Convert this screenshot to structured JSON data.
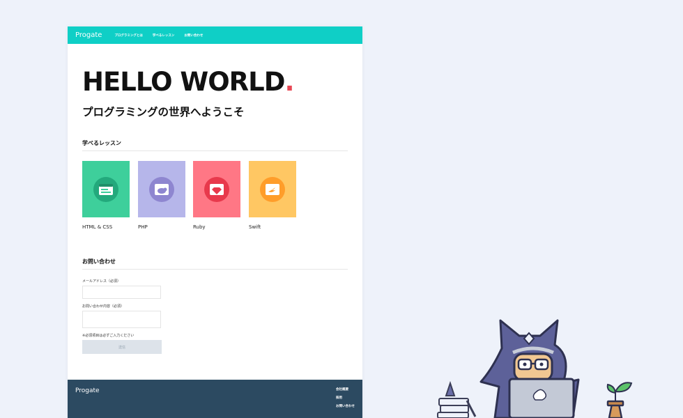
{
  "header": {
    "logo": "Progate",
    "nav": [
      "プログラミングとは",
      "学べるレッスン",
      "お問い合わせ"
    ]
  },
  "hero": {
    "title": "HELLO WORLD",
    "dot": ".",
    "subtitle": "プログラミングの世界へようこそ"
  },
  "lessons": {
    "heading": "学べるレッスン",
    "items": [
      {
        "label": "HTML & CSS",
        "bg": "#3ecf9b",
        "circle": "#23a97c",
        "icon": "html-css-icon"
      },
      {
        "label": "PHP",
        "bg": "#b6b6ea",
        "circle": "#8e86d0",
        "icon": "php-elephant-icon"
      },
      {
        "label": "Ruby",
        "bg": "#ff7785",
        "circle": "#e8394c",
        "icon": "ruby-gem-icon"
      },
      {
        "label": "Swift",
        "bg": "#ffc763",
        "circle": "#ff9d2a",
        "icon": "swift-bird-icon"
      }
    ]
  },
  "contact": {
    "heading": "お問い合わせ",
    "email_label": "メールアドレス（必須）",
    "message_label": "お問い合わせ内容（必須）",
    "note": "※必須項目は必ずご入力ください",
    "submit": "送信"
  },
  "footer": {
    "logo": "Progate",
    "links": [
      "会社概要",
      "採用",
      "お問い合わせ"
    ]
  },
  "colors": {
    "brand": "#0fcfc6",
    "footer": "#2c4a61",
    "accent_dot": "#e84855"
  }
}
